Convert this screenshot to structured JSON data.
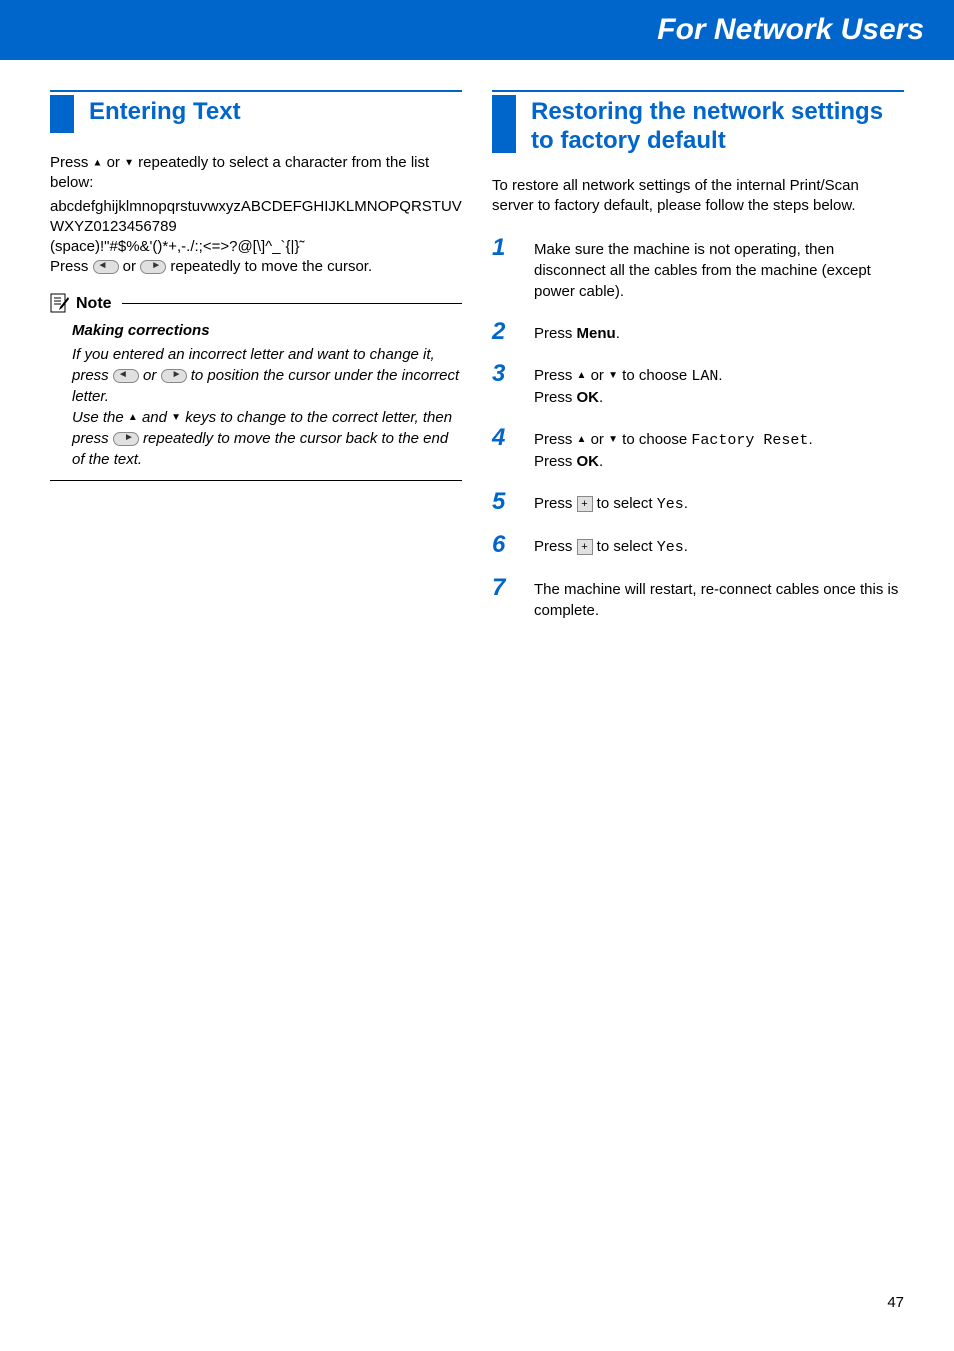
{
  "banner_title": "For Network Users",
  "left": {
    "section_title": "Entering Text",
    "para1_pre": "Press ",
    "para1_mid": " or ",
    "para1_post": " repeatedly to select a character from the list below:",
    "charset_line1": "abcdefghijklmnopqrstuvwxyzABCDEFGHIJKLMNOPQRSTUVWXYZ0123456789",
    "charset_line2": "(space)!\"#$%&'()*+,-./:;<=>?@[\\]^_`{|}˜",
    "para2_pre": "Press ",
    "para2_mid": " or ",
    "para2_post": " repeatedly to move the cursor.",
    "note_label": "Note",
    "note_subtitle": "Making corrections",
    "note_line1_pre": "If you entered an incorrect letter and want to change it, press ",
    "note_line1_mid": " or ",
    "note_line1_post": " to position the cursor under the incorrect letter.",
    "note_line2_pre": "Use the ",
    "note_line2_mid1": " and ",
    "note_line2_mid2": " keys to change to the correct letter, then press ",
    "note_line2_post": " repeatedly to move the cursor back to the end of the text."
  },
  "right": {
    "section_title": "Restoring the network settings to factory default",
    "intro": "To restore all network settings of the internal Print/Scan server to factory default, please follow the steps below.",
    "steps": [
      {
        "num": "1",
        "parts": [
          {
            "t": "Make sure the machine is not operating, then disconnect all the cables from the machine (except power cable)."
          }
        ]
      },
      {
        "num": "2",
        "parts": [
          {
            "t": "Press "
          },
          {
            "t": "Menu",
            "bold": true
          },
          {
            "t": "."
          }
        ]
      },
      {
        "num": "3",
        "parts": [
          {
            "t": "Press "
          },
          {
            "tri_up": true
          },
          {
            "t": " or "
          },
          {
            "tri_down": true
          },
          {
            "t": " to choose "
          },
          {
            "t": "LAN",
            "mono": true
          },
          {
            "t": "."
          },
          {
            "br": true
          },
          {
            "t": "Press "
          },
          {
            "t": "OK",
            "bold": true
          },
          {
            "t": "."
          }
        ]
      },
      {
        "num": "4",
        "parts": [
          {
            "t": "Press "
          },
          {
            "tri_up": true
          },
          {
            "t": " or "
          },
          {
            "tri_down": true
          },
          {
            "t": " to choose "
          },
          {
            "t": "Factory Reset",
            "mono": true
          },
          {
            "t": "."
          },
          {
            "br": true
          },
          {
            "t": "Press "
          },
          {
            "t": "OK",
            "bold": true
          },
          {
            "t": "."
          }
        ]
      },
      {
        "num": "5",
        "parts": [
          {
            "t": "Press "
          },
          {
            "plus": true
          },
          {
            "t": " to select "
          },
          {
            "t": "Yes",
            "mono": true
          },
          {
            "t": "."
          }
        ]
      },
      {
        "num": "6",
        "parts": [
          {
            "t": "Press "
          },
          {
            "plus": true
          },
          {
            "t": " to select "
          },
          {
            "t": "Yes",
            "mono": true
          },
          {
            "t": "."
          }
        ]
      },
      {
        "num": "7",
        "parts": [
          {
            "t": "The machine will restart, re-connect cables once this is complete."
          }
        ]
      }
    ]
  },
  "page_number": "47"
}
